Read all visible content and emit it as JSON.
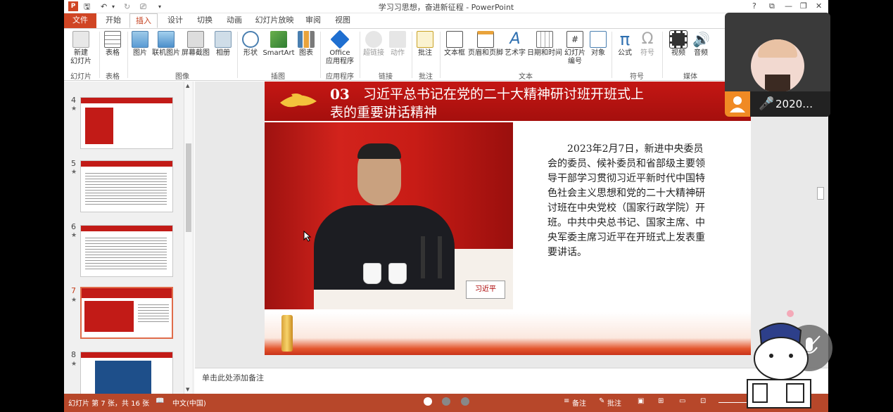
{
  "app": {
    "title": "学习习思想，奋进新征程 - PowerPoint",
    "window_controls": [
      "?",
      "⧉",
      "—",
      "❐",
      "✕"
    ]
  },
  "tabs": [
    "文件",
    "开始",
    "插入",
    "设计",
    "切换",
    "动画",
    "幻灯片放映",
    "审阅",
    "视图"
  ],
  "active_tab": "插入",
  "ribbon": {
    "buttons": [
      {
        "label": "新建\n幻灯片",
        "icon": "new-slide-icon"
      },
      {
        "label": "表格",
        "icon": "table-icon"
      },
      {
        "label": "图片",
        "icon": "picture-icon"
      },
      {
        "label": "联机图片",
        "icon": "online-picture-icon"
      },
      {
        "label": "屏幕截图",
        "icon": "screenshot-icon"
      },
      {
        "label": "相册",
        "icon": "album-icon"
      },
      {
        "label": "形状",
        "icon": "shapes-icon"
      },
      {
        "label": "SmartArt",
        "icon": "smartart-icon"
      },
      {
        "label": "图表",
        "icon": "chart-icon"
      },
      {
        "label": "Office\n应用程序",
        "icon": "office-apps-icon"
      },
      {
        "label": "超链接",
        "icon": "hyperlink-icon",
        "disabled": true
      },
      {
        "label": "动作",
        "icon": "action-icon",
        "disabled": true
      },
      {
        "label": "批注",
        "icon": "comment-icon"
      },
      {
        "label": "文本框",
        "icon": "textbox-icon"
      },
      {
        "label": "页眉和页脚",
        "icon": "header-footer-icon"
      },
      {
        "label": "艺术字",
        "icon": "wordart-icon"
      },
      {
        "label": "日期和时间",
        "icon": "date-time-icon"
      },
      {
        "label": "幻灯片\n编号",
        "icon": "slide-number-icon"
      },
      {
        "label": "对象",
        "icon": "object-icon"
      },
      {
        "label": "公式",
        "icon": "equation-icon"
      },
      {
        "label": "符号",
        "icon": "symbol-icon",
        "disabled": true
      },
      {
        "label": "视频",
        "icon": "video-icon"
      },
      {
        "label": "音频",
        "icon": "audio-icon"
      }
    ],
    "groups": [
      "幻灯片",
      "表格",
      "图像",
      "插图",
      "应用程序",
      "链接",
      "批注",
      "文本",
      "符号",
      "媒体"
    ]
  },
  "thumbnails": [
    {
      "num": "4",
      "star": "★"
    },
    {
      "num": "5",
      "star": "★"
    },
    {
      "num": "6",
      "star": "★"
    },
    {
      "num": "7",
      "star": "★",
      "selected": true
    },
    {
      "num": "8",
      "star": "★"
    }
  ],
  "slide": {
    "number": "03",
    "title_line1": "习近平总书记在党的二十大精神研讨班开班式上",
    "title_line2": "表的重要讲话精神",
    "body": "2023年2月7日，新进中央委员会的委员、候补委员和省部级主要领导干部学习贯彻习近平新时代中国特色社会主义思想和党的二十大精神研讨班在中央党校（国家行政学院）开班。中共中央总书记、国家主席、中央军委主席习近平在开班式上发表重要讲话。",
    "nameplate": "习近平"
  },
  "notes_placeholder": "单击此处添加备注",
  "status": {
    "slide_info": "幻灯片 第 7 张，共 16 张",
    "language": "中文(中国)",
    "notes": "备注",
    "comments": "批注"
  },
  "camera": {
    "name": "2020…"
  },
  "colors": {
    "accent": "#b7472a",
    "slide_red": "#c41714",
    "file_tab": "#d04524"
  }
}
